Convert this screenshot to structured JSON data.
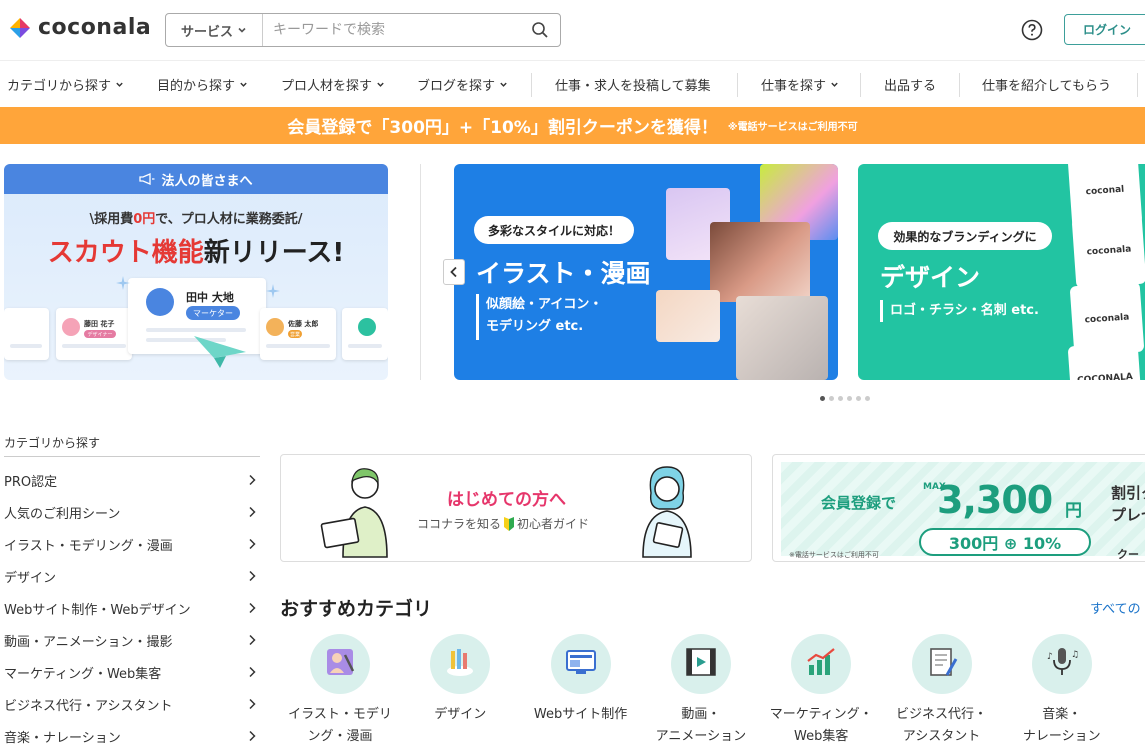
{
  "header": {
    "logo_text": "coconala",
    "search_category": "サービス",
    "search_placeholder": "キーワードで検索",
    "login_label": "ログイン"
  },
  "nav": {
    "items": [
      "カテゴリから探す",
      "目的から探す",
      "プロ人材を探す",
      "ブログを探す",
      "仕事・求人を投稿して募集",
      "仕事を探す",
      "出品する",
      "仕事を紹介してもらう"
    ]
  },
  "promo": {
    "main": "会員登録で「300円」+「10%」割引クーポンを獲得！",
    "note": "※電話サービスはご利用不可"
  },
  "carousel": {
    "slide1": {
      "header": "法人の皆さまへ",
      "sub_before": "\\採用費",
      "sub_em": "0円",
      "sub_after": "で、プロ人材に業務委託/",
      "title_red": "スカウト機能",
      "title_dark": "新リリース!",
      "main_name": "田中 大地",
      "main_tag": "マーケター",
      "left_name": "藤田 花子",
      "left_tag": "デザイナー",
      "right_name": "佐藤 太郎",
      "right_tag": "営業"
    },
    "slide2": {
      "pill": "多彩なスタイルに対応！",
      "title": "イラスト・漫画",
      "desc1": "似顔絵・アイコン・",
      "desc2": "モデリング etc."
    },
    "slide3": {
      "pill": "効果的なブランディングに",
      "title": "デザイン",
      "desc": "ロゴ・チラシ・名刺 etc.",
      "tile1": "coconal",
      "tile2": "coconala",
      "tile3": "coconala",
      "tile4": "COCONALA"
    },
    "dot_count": 6,
    "active_dot": 0
  },
  "sidebar": {
    "heading": "カテゴリから探す",
    "items": [
      "PRO認定",
      "人気のご利用シーン",
      "イラスト・モデリング・漫画",
      "デザイン",
      "Webサイト制作・Webデザイン",
      "動画・アニメーション・撮影",
      "マーケティング・Web集客",
      "ビジネス代行・アシスタント",
      "音楽・ナレーション"
    ]
  },
  "banner_beginner": {
    "title": "はじめての方へ",
    "sub_before": "ココナラを知る",
    "sub_after": "初心者ガイド"
  },
  "banner_coupon": {
    "lead": "会員登録で",
    "max": "MAX",
    "amount": "3,300",
    "yen": "円",
    "badge": "300円 ⊕ 10%",
    "side1": "割引ク",
    "side2": "プレセ",
    "side3": "クー",
    "note": "※電話サービスはご利用不可"
  },
  "recommended": {
    "title": "おすすめカテゴリ",
    "see_all": "すべての",
    "categories": [
      {
        "label": "イラスト・モデリ\nング・漫画",
        "icon": "illustration-icon"
      },
      {
        "label": "デザイン",
        "icon": "design-icon"
      },
      {
        "label": "Webサイト制作",
        "icon": "website-icon"
      },
      {
        "label": "動画・\nアニメーション",
        "icon": "video-icon"
      },
      {
        "label": "マーケティング・\nWeb集客",
        "icon": "marketing-icon"
      },
      {
        "label": "ビジネス代行・\nアシスタント",
        "icon": "business-icon"
      },
      {
        "label": "音楽・\nナレーション",
        "icon": "music-icon"
      }
    ]
  },
  "colors": {
    "brand_teal": "#3d9f9a",
    "promo_orange": "#ffa53a",
    "slide2_blue": "#1e7fe5",
    "slide3_green": "#22c4a2",
    "accent_pink": "#e6366b"
  }
}
